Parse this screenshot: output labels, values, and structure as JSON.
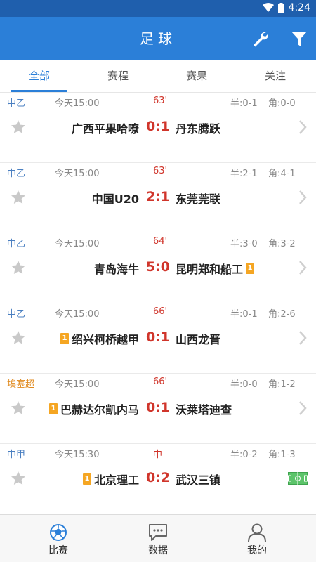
{
  "status_bar": {
    "time": "4:24"
  },
  "app_bar": {
    "title": "足球"
  },
  "tabs": [
    {
      "label": "全部",
      "active": true
    },
    {
      "label": "赛程",
      "active": false
    },
    {
      "label": "赛果",
      "active": false
    },
    {
      "label": "关注",
      "active": false
    }
  ],
  "matches": [
    {
      "league": "中乙",
      "league_color": "#4a7fc1",
      "time": "今天15:00",
      "minute": "63'",
      "half": "半:0-1",
      "corner": "角:0-0",
      "home": "广西平果哈嘹",
      "home_card": "",
      "score": "0:1",
      "away": "丹东腾跃",
      "away_card": "",
      "end_icon": "arrow"
    },
    {
      "league": "中乙",
      "league_color": "#4a7fc1",
      "time": "今天15:00",
      "minute": "63'",
      "half": "半:2-1",
      "corner": "角:4-1",
      "home": "中国U20",
      "home_card": "",
      "score": "2:1",
      "away": "东莞莞联",
      "away_card": "",
      "end_icon": "arrow"
    },
    {
      "league": "中乙",
      "league_color": "#4a7fc1",
      "time": "今天15:00",
      "minute": "64'",
      "half": "半:3-0",
      "corner": "角:3-2",
      "home": "青岛海牛",
      "home_card": "",
      "score": "5:0",
      "away": "昆明郑和船工",
      "away_card": "1",
      "end_icon": "arrow"
    },
    {
      "league": "中乙",
      "league_color": "#4a7fc1",
      "time": "今天15:00",
      "minute": "66'",
      "half": "半:0-1",
      "corner": "角:2-6",
      "home": "绍兴柯桥越甲",
      "home_card": "1",
      "score": "0:1",
      "away": "山西龙晋",
      "away_card": "",
      "end_icon": "arrow"
    },
    {
      "league": "埃塞超",
      "league_color": "#e08a1e",
      "time": "今天15:00",
      "minute": "66'",
      "half": "半:0-0",
      "corner": "角:1-2",
      "home": "巴赫达尔凯内马",
      "home_card": "1",
      "score": "0:1",
      "away": "沃莱塔迪查",
      "away_card": "",
      "end_icon": "arrow"
    },
    {
      "league": "中甲",
      "league_color": "#4a7fc1",
      "time": "今天15:30",
      "minute": "中",
      "half": "半:0-2",
      "corner": "角:1-3",
      "home": "北京理工",
      "home_card": "1",
      "score": "0:2",
      "away": "武汉三镇",
      "away_card": "",
      "end_icon": "pitch"
    }
  ],
  "bottom_nav": [
    {
      "label": "比赛",
      "icon": "football-icon",
      "active": true
    },
    {
      "label": "数据",
      "icon": "chat-icon",
      "active": false
    },
    {
      "label": "我的",
      "icon": "user-icon",
      "active": false
    }
  ],
  "colors": {
    "primary": "#2b7fd8",
    "status_bar": "#1f5fad",
    "score": "#d0352b",
    "card": "#f5a623"
  }
}
